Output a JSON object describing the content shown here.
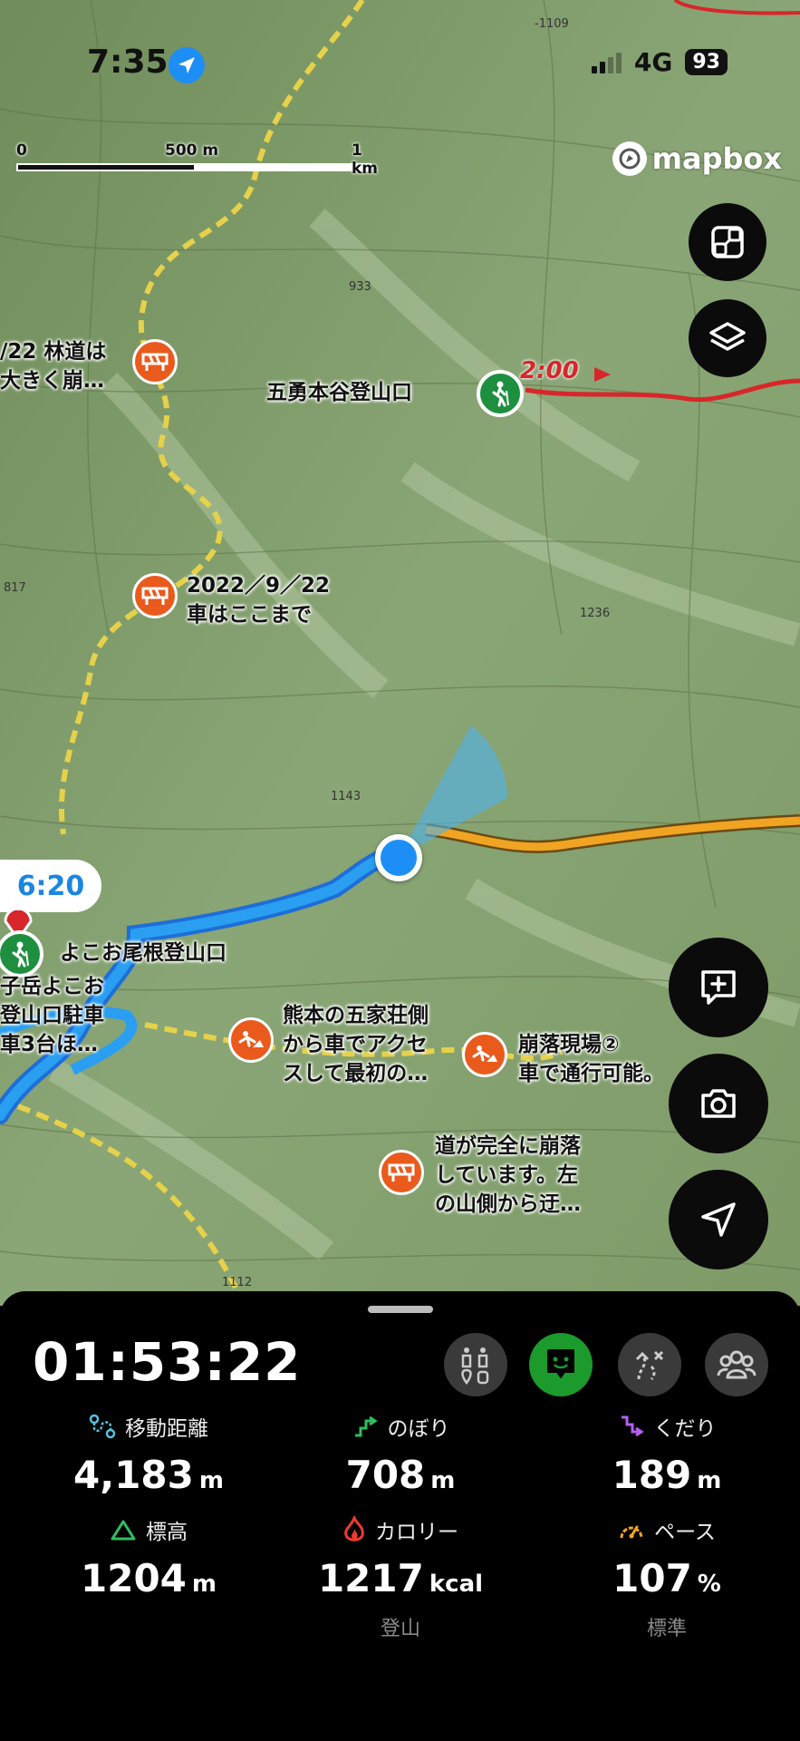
{
  "status_bar": {
    "time": "7:35",
    "network": "4G",
    "battery": "93"
  },
  "map": {
    "scale": {
      "label_0": "0",
      "label_500": "500 m",
      "label_1k": "1 km"
    },
    "attribution": "mapbox",
    "labels": {
      "trailhead_gouyuu": "五勇本谷登山口",
      "route_time_2": "2:00",
      "note_rindo_1": "/22 林道は",
      "note_rindo_2": "大きく崩…",
      "note_2022_1": "2022／9／22",
      "note_2022_2": "車はここまで",
      "trailhead_yokoo": "よこお尾根登山口",
      "parking_1": "子岳よこお",
      "parking_2": "登山口駐車",
      "parking_3": "車3台ほ…",
      "note_gokasho_1": "熊本の五家荘側",
      "note_gokasho_2": "から車でアクセ",
      "note_gokasho_3": "スして最初の…",
      "note_collapse2_1": "崩落現場②",
      "note_collapse2_2": "車で通行可能。",
      "note_road_1": "道が完全に崩落",
      "note_road_2": "しています。左",
      "note_road_3": "の山側から迂…",
      "time_bubble": "6:20"
    },
    "colors": {
      "track": "#2a8fe0",
      "planned_route_orange": "#f0a422",
      "planned_route_red": "#d8262a",
      "forest_road": "#e6d14a",
      "marker_orange": "#ea5a1c",
      "marker_green": "#1d8f3e"
    }
  },
  "controls": {
    "fit_icon": "fit-bounds-icon",
    "layers_icon": "layers-icon",
    "add_note_icon": "add-note-icon",
    "camera_icon": "camera-icon",
    "locate_icon": "locate-arrow-icon"
  },
  "panel": {
    "elapsed_time": "01:53:22",
    "tabs": [
      {
        "icon": "route-points-icon",
        "active": false
      },
      {
        "icon": "activity-face-icon",
        "active": true
      },
      {
        "icon": "route-deviation-icon",
        "active": false
      },
      {
        "icon": "group-icon",
        "active": false
      }
    ],
    "stats": {
      "distance": {
        "label": "移動距離",
        "value": "4,183",
        "unit": "m",
        "color": "#56c1dd"
      },
      "ascent": {
        "label": "のぼり",
        "value": "708",
        "unit": "m",
        "color": "#2fbe5e"
      },
      "descent": {
        "label": "くだり",
        "value": "189",
        "unit": "m",
        "color": "#b560f0"
      },
      "altitude": {
        "label": "標高",
        "value": "1204",
        "unit": "m",
        "color": "#2fbe5e"
      },
      "calories": {
        "label": "カロリー",
        "value": "1217",
        "unit": "kcal",
        "sub": "登山",
        "color": "#ef3b2f"
      },
      "pace": {
        "label": "ペース",
        "value": "107",
        "unit": "%",
        "sub": "標準",
        "color": "#f3a51e"
      }
    }
  }
}
